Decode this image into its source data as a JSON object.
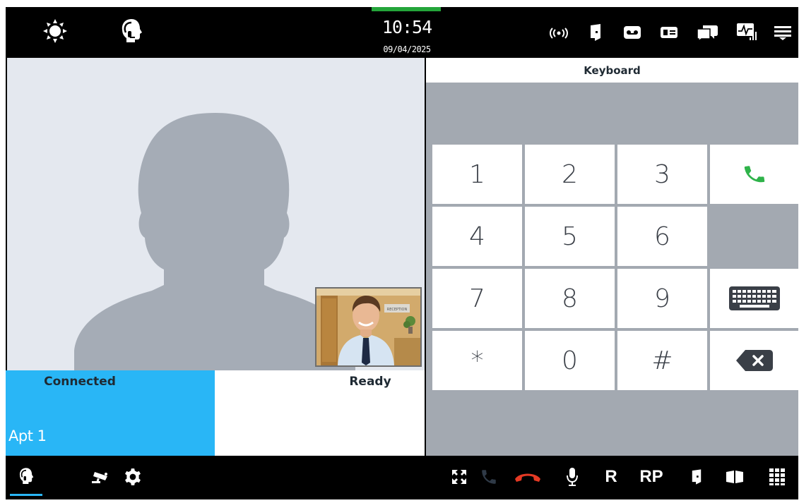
{
  "header": {
    "time": "10:54",
    "date": "09/04/2025",
    "icons": [
      "brightness-icon",
      "headset-agent-icon",
      "wireless-icon",
      "door-icon",
      "voicemail-icon",
      "id-card-icon",
      "chat-icon",
      "monitor-signal-icon",
      "menu-icon"
    ]
  },
  "video": {
    "caller_placeholder": "person-silhouette-icon",
    "pip_sign": "RECEPTION"
  },
  "call_status": {
    "connected_label": "Connected",
    "apartment": "Apt 1",
    "ready_label": "Ready"
  },
  "keyboard": {
    "title": "Keyboard",
    "display_value": "",
    "keys": [
      "1",
      "2",
      "3",
      "4",
      "5",
      "6",
      "7",
      "8",
      "9",
      "*",
      "0",
      "#"
    ],
    "actions": [
      "call-icon",
      "keyboard-icon",
      "backspace-icon"
    ]
  },
  "bottom_toolbar": {
    "tabs": [
      "headset-agent-icon",
      "camera-icon",
      "gear-icon"
    ],
    "actions": [
      "fullscreen-icon",
      "call-icon",
      "hangup-icon",
      "microphone-icon",
      "R",
      "RP",
      "door-icon",
      "gate-icon",
      "keypad-icon"
    ],
    "r_label": "R",
    "rp_label": "RP"
  },
  "colors": {
    "accent": "#29b6f6",
    "status_green": "#24a53a",
    "call_green": "#2fb34a",
    "hangup_red": "#e53a24",
    "panel_gray": "#a3a9b1"
  }
}
